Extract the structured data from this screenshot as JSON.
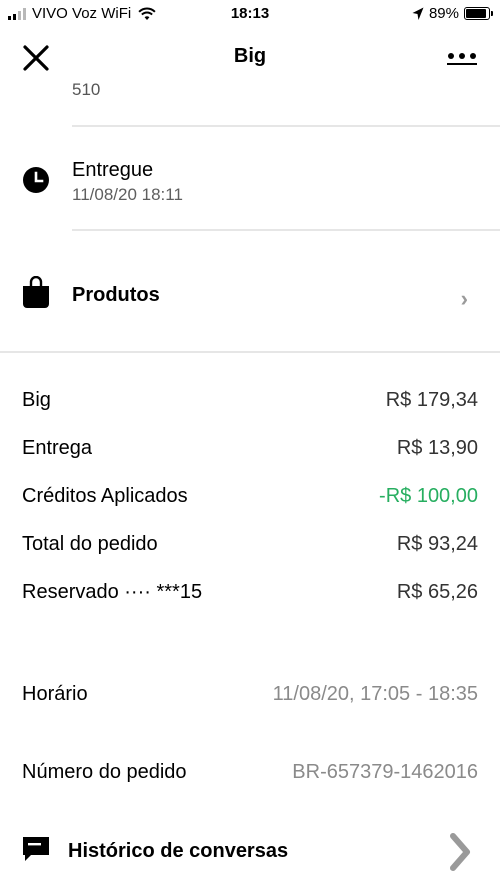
{
  "status_bar": {
    "carrier": "VIVO Voz WiFi",
    "time": "18:13",
    "battery": "89%",
    "battery_level": 0.89
  },
  "nav": {
    "title": "Big",
    "close_icon": "close-icon",
    "more_icon": "more-horizontal-icon"
  },
  "address_tail": "510",
  "delivery_status": {
    "icon": "clock-icon",
    "label": "Entregue",
    "time": "11/08/20 18:11"
  },
  "products": {
    "icon": "bag-icon",
    "label": "Produtos",
    "chevron": "›"
  },
  "summary": [
    {
      "label": "Big",
      "value": "R$ 179,34"
    },
    {
      "label": "Entrega",
      "value": "R$ 13,90"
    },
    {
      "label": "Créditos Aplicados",
      "value": "-R$ 100,00"
    },
    {
      "label": "Total do pedido",
      "value": "R$ 93,24"
    },
    {
      "label": "Reservado ···· ***15",
      "value": "R$ 65,26"
    }
  ],
  "details": [
    {
      "label": "Horário",
      "value": "11/08/20, 17:05 - 18:35"
    },
    {
      "label": "Número do pedido",
      "value": "BR-657379-1462016"
    }
  ],
  "chat_history": {
    "icon": "chat-icon",
    "label": "Histórico de conversas"
  },
  "colors": {
    "credit_green": "#27ae60",
    "divider": "#e6e6e6"
  }
}
